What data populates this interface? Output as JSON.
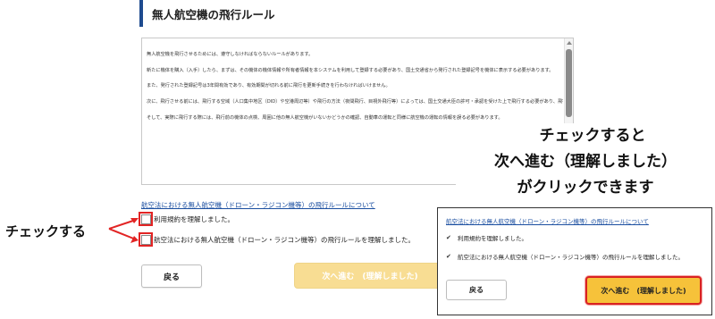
{
  "page": {
    "title": "無人航空機の飛行ルール",
    "terms_paragraphs": [
      "無人航空機を飛行させるためには、遵守しなければならないルールがあります。",
      "新たに機体を購入（入手）したら、まずは、その機体の機体情報や所有者情報を本システムを利用して登録する必要があり、国土交通省から発行された登録記号を機体に表示する必要があります。",
      "また、発行された登録記号は3年間有効であり、有効期間が切れる前に飛行を更新手続きを行わなければいけません。",
      "次に、飛行させる前には、飛行する空域（人口集中地区（DID）や空港周辺等）や飛行の方法（夜間飛行、目視外飛行等）によっては、国土交通大臣の許可・承認を受けた上で飛行する必要があり、飛行が許可承認に該当するかどうかの確認が必要です。また、国の重要施設（首相官邸、皇居等）や空港等の一部施設の上空では飛行する必要があります。",
      "そして、実際に飛行する際には、飛行前の機体の点検、周囲に他の無人航空機がいないかどうかの確認、自動車の運転と同様に航空機の運転の情報を誤る必要があります。"
    ],
    "rule_link": "航空法における無人航空機（ドローン・ラジコン機等）の飛行ルールについて",
    "checkbox_terms": "利用規約を理解しました。",
    "checkbox_rules": "航空法における無人航空機（ドローン・ラジコン機等）の飛行ルールを理解しました。",
    "back_button": "戻る",
    "next_button": "次へ進む　(理解しました)"
  },
  "annotations": {
    "left_callout": "チェックする",
    "right_callout_lines": [
      "チェックすると",
      "次へ進む（理解しました）",
      "がクリックできます"
    ],
    "highlight_color": "#e22424"
  },
  "inset": {
    "rule_link": "航空法における無人航空機（ドローン・ラジコン機等）の飛行ルールについて",
    "checkbox_terms": "利用規約を理解しました。",
    "checkbox_rules": "航空法における無人航空機（ドローン・ラジコン機等）の飛行ルールを理解しました。",
    "back_button": "戻る",
    "next_button": "次へ進む　(理解しました)"
  },
  "colors": {
    "accent": "#1e4b8f",
    "link": "#1a4ea0",
    "next_disabled": "#f8dd93",
    "next_enabled": "#f6c23a"
  }
}
